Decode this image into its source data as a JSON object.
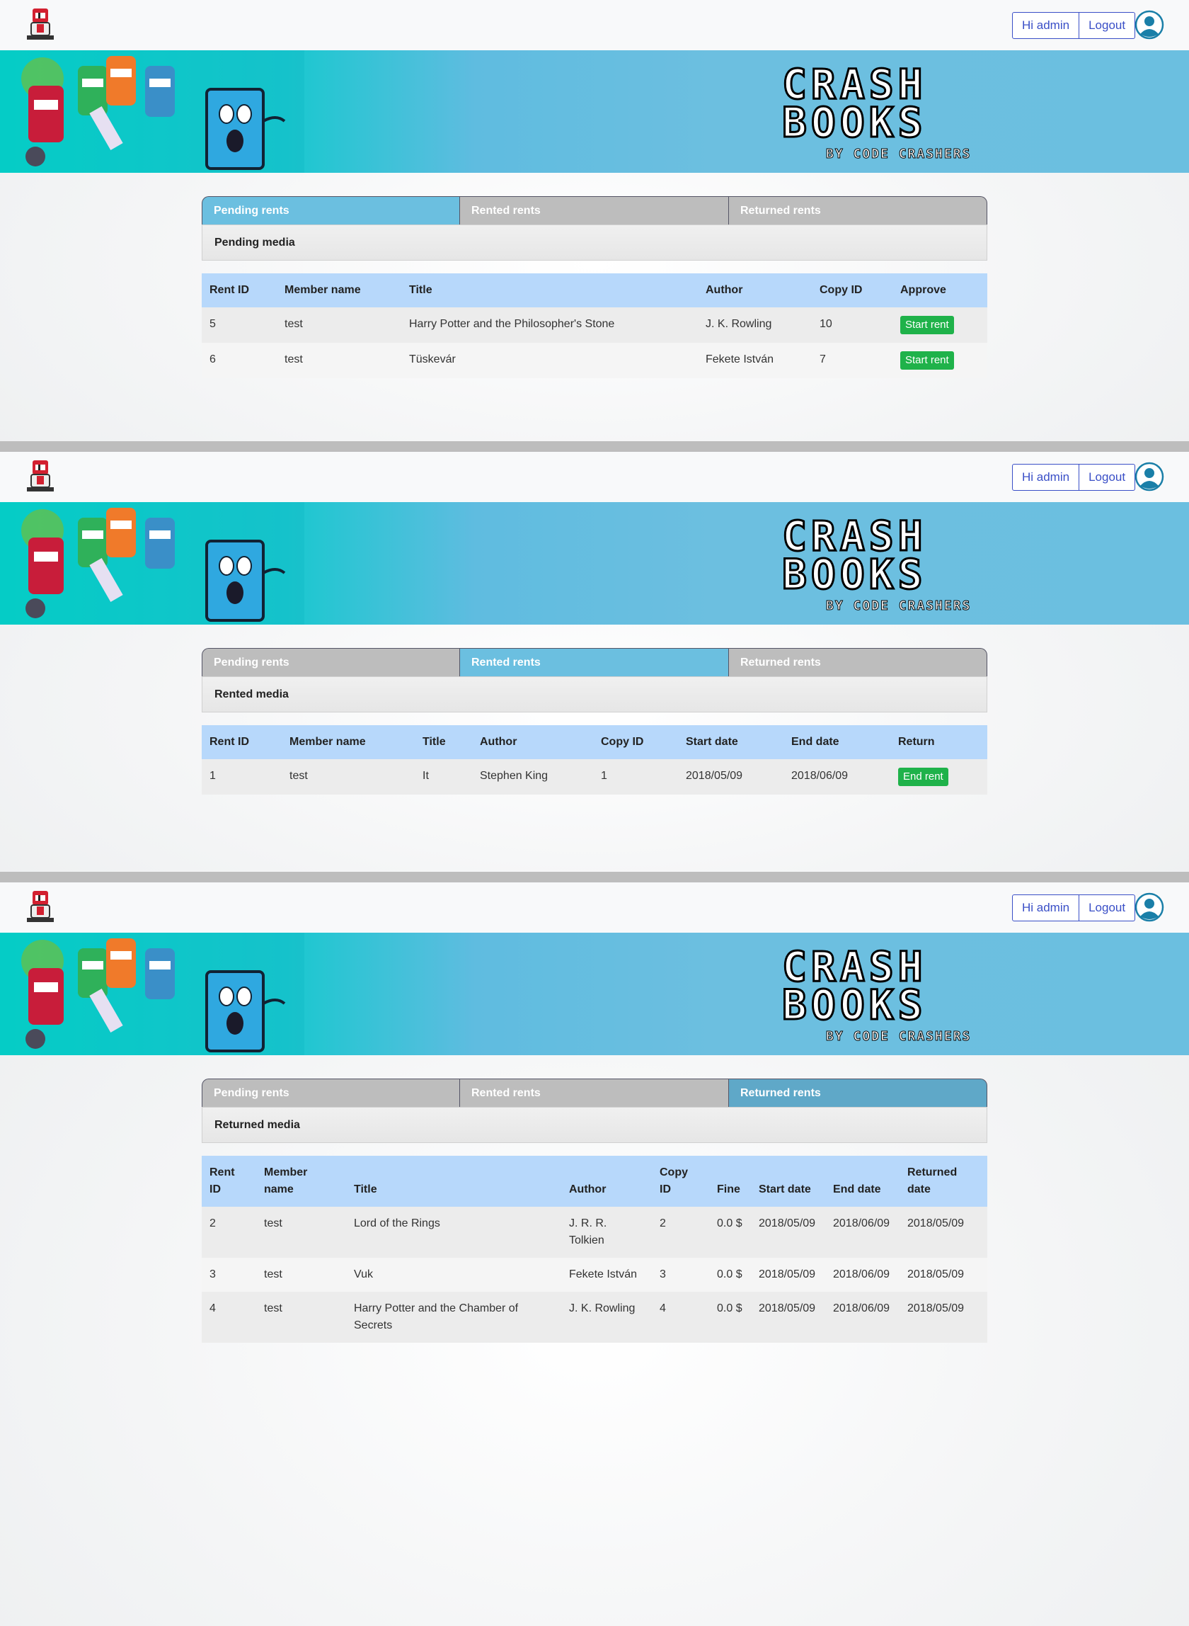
{
  "header": {
    "greeting": "Hi admin",
    "logout": "Logout"
  },
  "banner": {
    "brand_line1": "CRASH",
    "brand_line2": "BOOKS",
    "brand_line3": "BY CODE CRASHERS"
  },
  "tabs": [
    "Pending rents",
    "Rented rents",
    "Returned rents"
  ],
  "pending": {
    "heading": "Pending media",
    "columns": [
      "Rent ID",
      "Member name",
      "Title",
      "Author",
      "Copy ID",
      "Approve"
    ],
    "rows": [
      {
        "rent_id": "5",
        "member": "test",
        "title": "Harry Potter and the Philosopher's Stone",
        "author": "J. K. Rowling",
        "copy_id": "10",
        "action": "Start rent"
      },
      {
        "rent_id": "6",
        "member": "test",
        "title": "Tüskevár",
        "author": "Fekete István",
        "copy_id": "7",
        "action": "Start rent"
      }
    ]
  },
  "rented": {
    "heading": "Rented media",
    "columns": [
      "Rent ID",
      "Member name",
      "Title",
      "Author",
      "Copy ID",
      "Start date",
      "End date",
      "Return"
    ],
    "rows": [
      {
        "rent_id": "1",
        "member": "test",
        "title": "It",
        "author": "Stephen King",
        "copy_id": "1",
        "start": "2018/05/09",
        "end": "2018/06/09",
        "action": "End rent"
      }
    ]
  },
  "returned": {
    "heading": "Returned media",
    "columns": [
      "Rent ID",
      "Member name",
      "Title",
      "Author",
      "Copy ID",
      "Fine",
      "Start date",
      "End date",
      "Returned date"
    ],
    "rows": [
      {
        "rent_id": "2",
        "member": "test",
        "title": "Lord of the Rings",
        "author": "J. R. R. Tolkien",
        "copy_id": "2",
        "fine": "0.0 $",
        "start": "2018/05/09",
        "end": "2018/06/09",
        "returned": "2018/05/09"
      },
      {
        "rent_id": "3",
        "member": "test",
        "title": "Vuk",
        "author": "Fekete István",
        "copy_id": "3",
        "fine": "0.0 $",
        "start": "2018/05/09",
        "end": "2018/06/09",
        "returned": "2018/05/09"
      },
      {
        "rent_id": "4",
        "member": "test",
        "title": "Harry Potter and the Chamber of Secrets",
        "author": "J. K. Rowling",
        "copy_id": "4",
        "fine": "0.0 $",
        "start": "2018/05/09",
        "end": "2018/06/09",
        "returned": "2018/05/09"
      }
    ]
  },
  "colors": {
    "tab_active": "#6bbfe0",
    "tab_inactive": "#bdbdbd",
    "table_header": "#b7d8fb",
    "action_green": "#1fb24a",
    "link_blue": "#3a4fc7"
  }
}
